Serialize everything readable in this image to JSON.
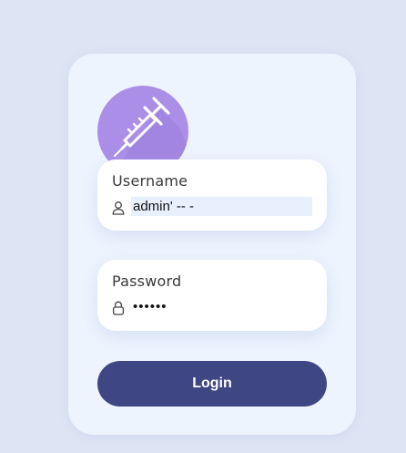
{
  "login_form": {
    "logo_icon": "syringe-icon",
    "username": {
      "label": "Username",
      "icon": "user-icon",
      "value": "admin' -- -"
    },
    "password": {
      "label": "Password",
      "icon": "lock-icon",
      "value": "••••••"
    },
    "login_label": "Login"
  },
  "colors": {
    "page_background": "#dde5f4",
    "card_background": "#eef4fe",
    "logo_circle": "#ab8ee7",
    "button": "#3e4684",
    "autofill_highlight": "#e8f0fe"
  }
}
